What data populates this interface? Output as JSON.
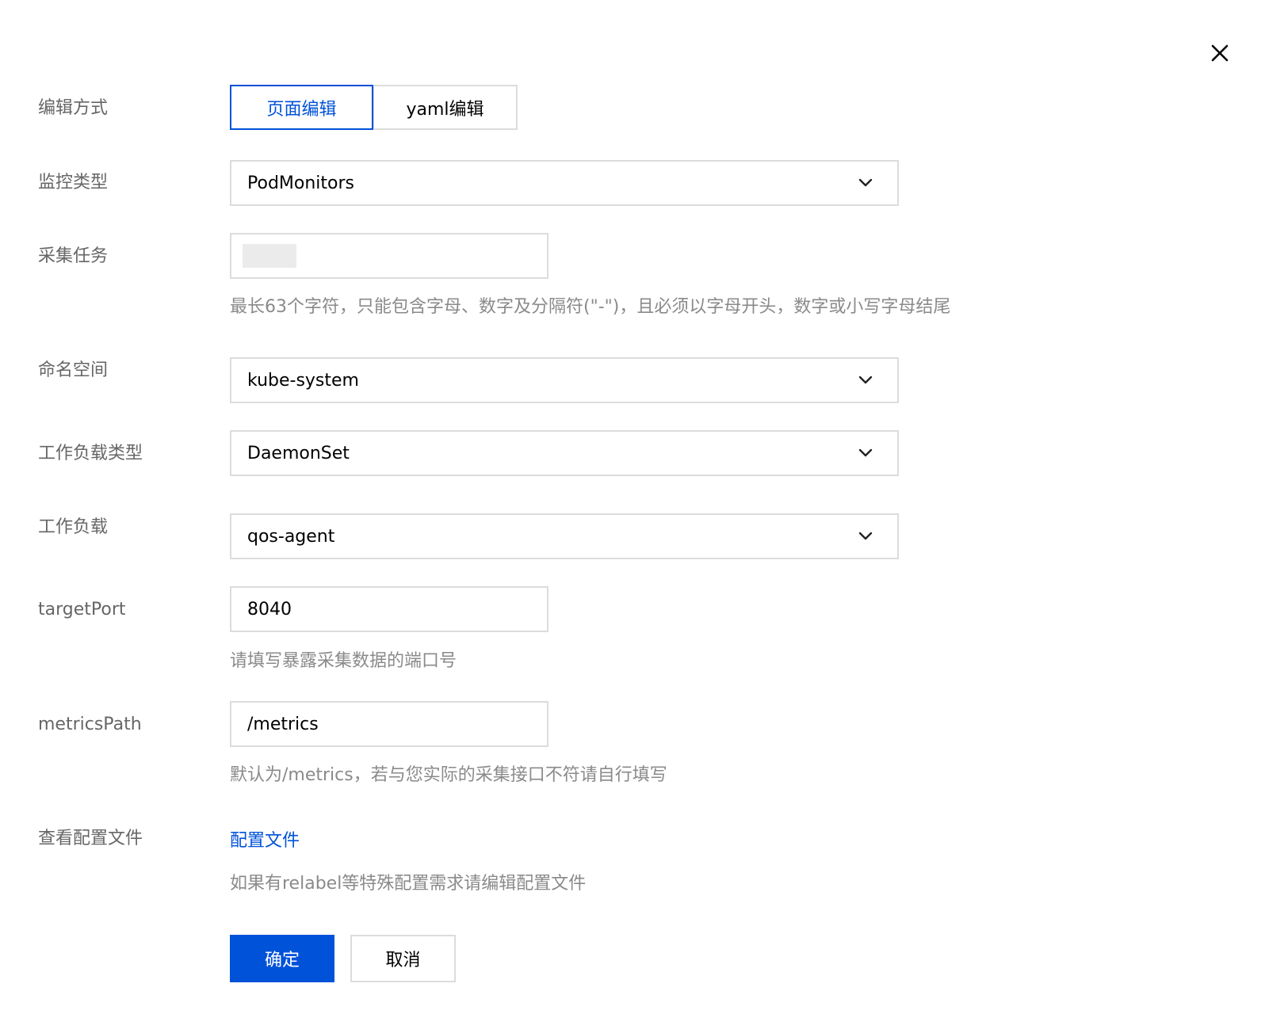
{
  "icons": {
    "close": "close-icon",
    "dropdown": "chevron-down-icon"
  },
  "colors": {
    "primary": "#0052d9",
    "label": "#666666",
    "hint": "#8a8a8a",
    "border": "#dcdcdc"
  },
  "form": {
    "edit_mode": {
      "label": "编辑方式",
      "options": [
        "页面编辑",
        "yaml编辑"
      ],
      "selected": "页面编辑"
    },
    "monitor_type": {
      "label": "监控类型",
      "value": "PodMonitors"
    },
    "collect_task": {
      "label": "采集任务",
      "value": "",
      "hint": "最长63个字符，只能包含字母、数字及分隔符(\"-\")，且必须以字母开头，数字或小写字母结尾"
    },
    "namespace": {
      "label": "命名空间",
      "value": "kube-system"
    },
    "workload_type": {
      "label": "工作负载类型",
      "value": "DaemonSet"
    },
    "workload": {
      "label": "工作负载",
      "value": "qos-agent"
    },
    "target_port": {
      "label": "targetPort",
      "value": "8040",
      "hint": "请填写暴露采集数据的端口号"
    },
    "metrics_path": {
      "label": "metricsPath",
      "value": "/metrics",
      "hint": "默认为/metrics，若与您实际的采集接口不符请自行填写"
    },
    "config_file": {
      "label": "查看配置文件",
      "link": "配置文件",
      "hint": "如果有relabel等特殊配置需求请编辑配置文件"
    }
  },
  "actions": {
    "confirm": "确定",
    "cancel": "取消"
  }
}
